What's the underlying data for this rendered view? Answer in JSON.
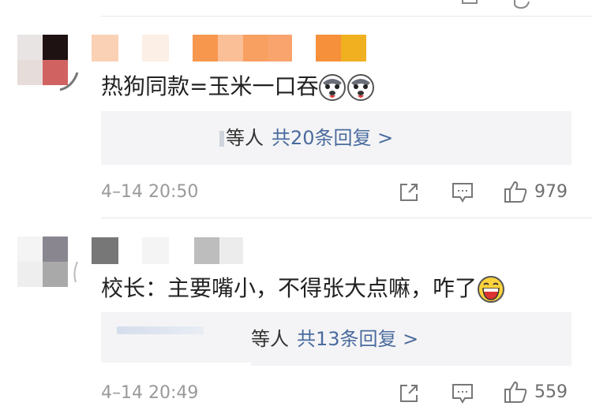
{
  "comments": [
    {
      "text": "热狗同款=玉米一口吞",
      "emoji": [
        "husky-face",
        "husky-face"
      ],
      "reply_who": "等人",
      "reply_count": "共20条回复 >",
      "time": "4–14 20:50",
      "likes": "979"
    },
    {
      "text": "校长：主要嘴小，不得张大点嘛，咋了",
      "emoji": [
        "grinning-face"
      ],
      "reply_who": "等人",
      "reply_count": "共13条回复 >",
      "time": "4–14 20:49",
      "likes": "559"
    }
  ],
  "colors": {
    "link": "#4a6b9e",
    "meta": "#9a9a9a",
    "reply_bg": "#f4f4f6"
  },
  "icons": [
    "share-icon",
    "comment-icon",
    "thumbs-up-icon"
  ]
}
